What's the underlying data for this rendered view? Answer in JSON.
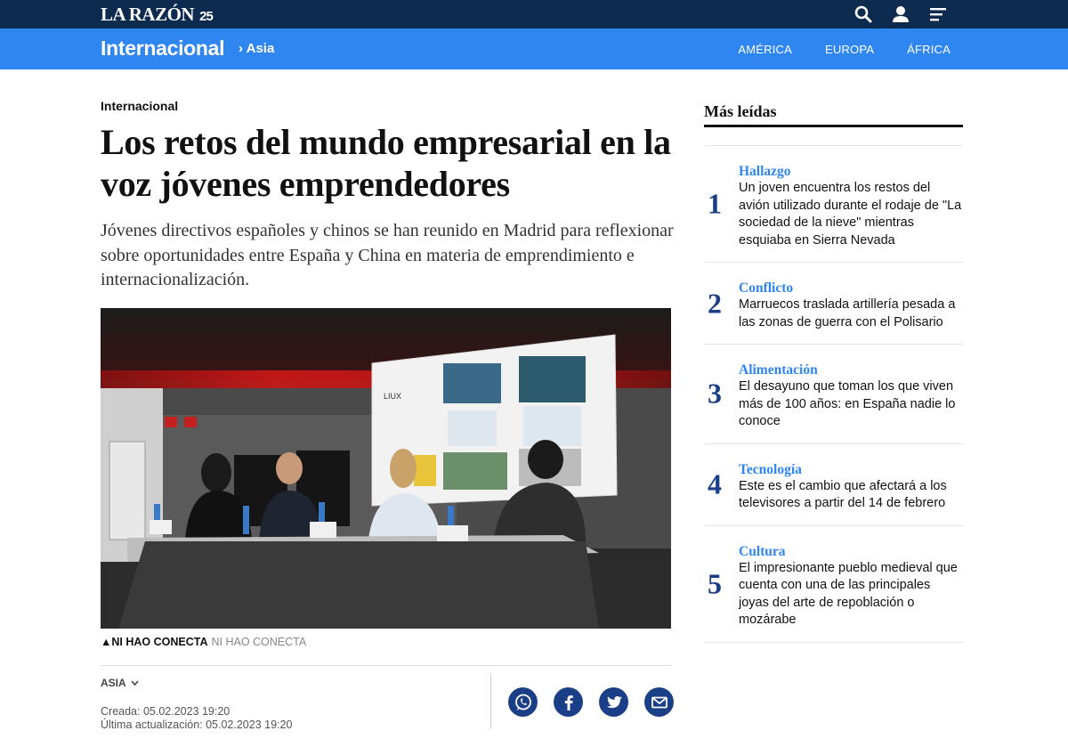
{
  "brand": {
    "logo_text": "LA RAZÓN",
    "anniversary": "25"
  },
  "header_icons": [
    "search-icon",
    "user-icon",
    "menu-icon"
  ],
  "section": {
    "title": "Internacional",
    "breadcrumb": "› Asia",
    "nav": [
      "AMÉRICA",
      "EUROPA",
      "ÁFRICA"
    ]
  },
  "article": {
    "kicker": "Internacional",
    "headline": "Los retos del mundo empresarial en la voz jóvenes emprendedores",
    "subtitle": "Jóvenes directivos españoles y chinos se han reunido en Madrid para reflexionar sobre oportunidades entre España y China en materia de emprendimiento e internacionalización.",
    "photo_caption_credit": "▲NI HAO CONECTA",
    "photo_caption_source": "NI HAO CONECTA",
    "photo_slide_brand": "LIUX",
    "tag": "ASIA",
    "created": "Creada: 05.02.2023 19:20",
    "updated": "Última actualización: 05.02.2023 19:20",
    "share": [
      "whatsapp-icon",
      "facebook-icon",
      "twitter-icon",
      "email-icon"
    ]
  },
  "sidebar": {
    "title": "Más leídas",
    "items": [
      {
        "num": "1",
        "category": "Hallazgo",
        "text": "Un joven encuentra los restos del avión utilizado durante el rodaje de \"La sociedad de la nieve\" mientras esquiaba en Sierra Nevada"
      },
      {
        "num": "2",
        "category": "Conflicto",
        "text": "Marruecos traslada artillería pesada a las zonas de guerra con el Polisario"
      },
      {
        "num": "3",
        "category": "Alimentación",
        "text": "El desayuno que toman los que viven más de 100 años: en España nadie lo conoce"
      },
      {
        "num": "4",
        "category": "Tecnología",
        "text": "Este es el cambio que afectará a los televisores a partir del 14 de febrero"
      },
      {
        "num": "5",
        "category": "Cultura",
        "text": "El impresionante pueblo medieval que cuenta con una de las principales joyas del arte de repoblación o mozárabe"
      }
    ]
  },
  "colors": {
    "topbar": "#0d2a4f",
    "section_bar": "#2f86f0",
    "accent_dark": "#1a3f86"
  }
}
